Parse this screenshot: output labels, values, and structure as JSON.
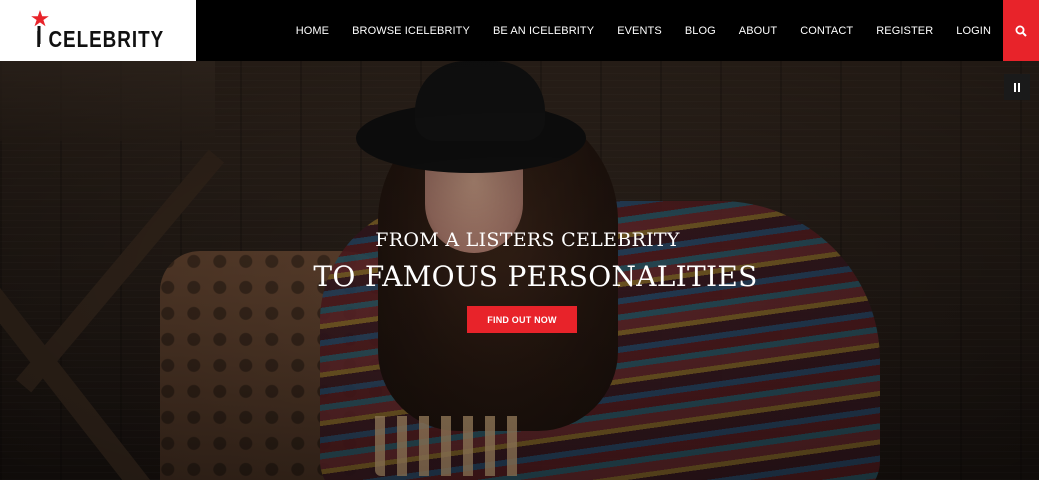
{
  "brand": {
    "name": "I CELEBRITY",
    "logo_icon": "star-icon",
    "accent_color": "#e8232a"
  },
  "nav": {
    "items": [
      {
        "label": "HOME"
      },
      {
        "label": "BROWSE ICELEBRITY"
      },
      {
        "label": "BE AN ICELEBRITY"
      },
      {
        "label": "EVENTS"
      },
      {
        "label": "BLOG"
      },
      {
        "label": "ABOUT"
      },
      {
        "label": "CONTACT"
      },
      {
        "label": "REGISTER"
      },
      {
        "label": "LOGIN"
      }
    ],
    "search_icon": "search-icon"
  },
  "hero": {
    "line1": "FROM A LISTERS CELEBRITY",
    "line2": "TO FAMOUS PERSONALITIES",
    "cta_label": "FIND OUT NOW",
    "pause_icon": "pause-icon"
  }
}
